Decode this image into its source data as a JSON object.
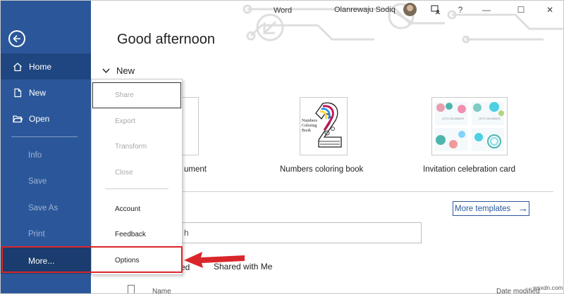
{
  "titlebar": {
    "app_title": "Word",
    "user_name": "Olanrewaju Sodiq",
    "help_label": "?",
    "minimize_label": "—",
    "maximize_label": "☐",
    "close_label": "✕"
  },
  "nav": {
    "home": "Home",
    "new": "New",
    "open": "Open",
    "info": "Info",
    "save": "Save",
    "save_as": "Save As",
    "print": "Print",
    "more": "More..."
  },
  "main": {
    "greeting": "Good afternoon",
    "new_heading": "New",
    "templates": [
      {
        "label": "Blank document"
      },
      {
        "label": "Numbers coloring book",
        "cover_text": "Numbers Coloring Book"
      },
      {
        "label": "Invitation celebration card",
        "cover_text": "LET'S CELEBRATE"
      }
    ],
    "blank_label_visible": "ument",
    "more_templates": "More templates",
    "search_placeholder_visible": "h",
    "tab_recent_visible": "ed",
    "tab_shared": "Shared with Me",
    "col_name": "Name",
    "col_date": "Date modified"
  },
  "menu": {
    "items": [
      "Share",
      "Export",
      "Transform",
      "Close",
      "Account",
      "Feedback",
      "Options"
    ]
  },
  "watermark": "wsxdn.com",
  "colors": {
    "nav_bg": "#2b579a",
    "highlight_red": "#d9262b",
    "accent_blue": "#2b579a"
  }
}
